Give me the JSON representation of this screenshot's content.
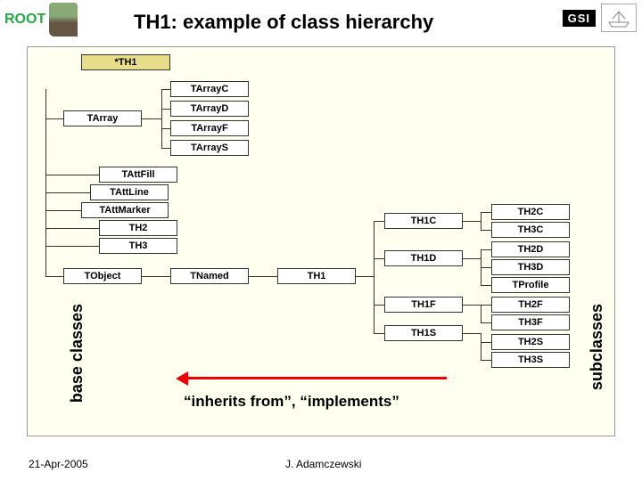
{
  "header": {
    "logo_left_text": "ROOT",
    "logo_right_text": "GSI",
    "title": "TH1: example of class hierarchy"
  },
  "labels": {
    "base_classes": "base classes",
    "subclasses": "subclasses",
    "inherits": "“inherits from”, “implements”"
  },
  "footer": {
    "date": "21-Apr-2005",
    "author": "J. Adamczewski"
  },
  "boxes": {
    "th1_top": "*TH1",
    "tarrayc": "TArrayC",
    "tarrayd": "TArrayD",
    "tarrayf": "TArrayF",
    "tarrays": "TArrayS",
    "tarray": "TArray",
    "tattfill": "TAttFill",
    "tattline": "TAttLine",
    "tattmarker": "TAttMarker",
    "th2": "TH2",
    "th3": "TH3",
    "tobject": "TObject",
    "tnamed": "TNamed",
    "th1_mid": "TH1",
    "th1c": "TH1C",
    "th1d": "TH1D",
    "th1f": "TH1F",
    "th1s": "TH1S",
    "th2c": "TH2C",
    "th3c": "TH3C",
    "th2d": "TH2D",
    "th3d": "TH3D",
    "tprofile": "TProfile",
    "th2f": "TH2F",
    "th3f": "TH3F",
    "th2s": "TH2S",
    "th3s": "TH3S"
  }
}
